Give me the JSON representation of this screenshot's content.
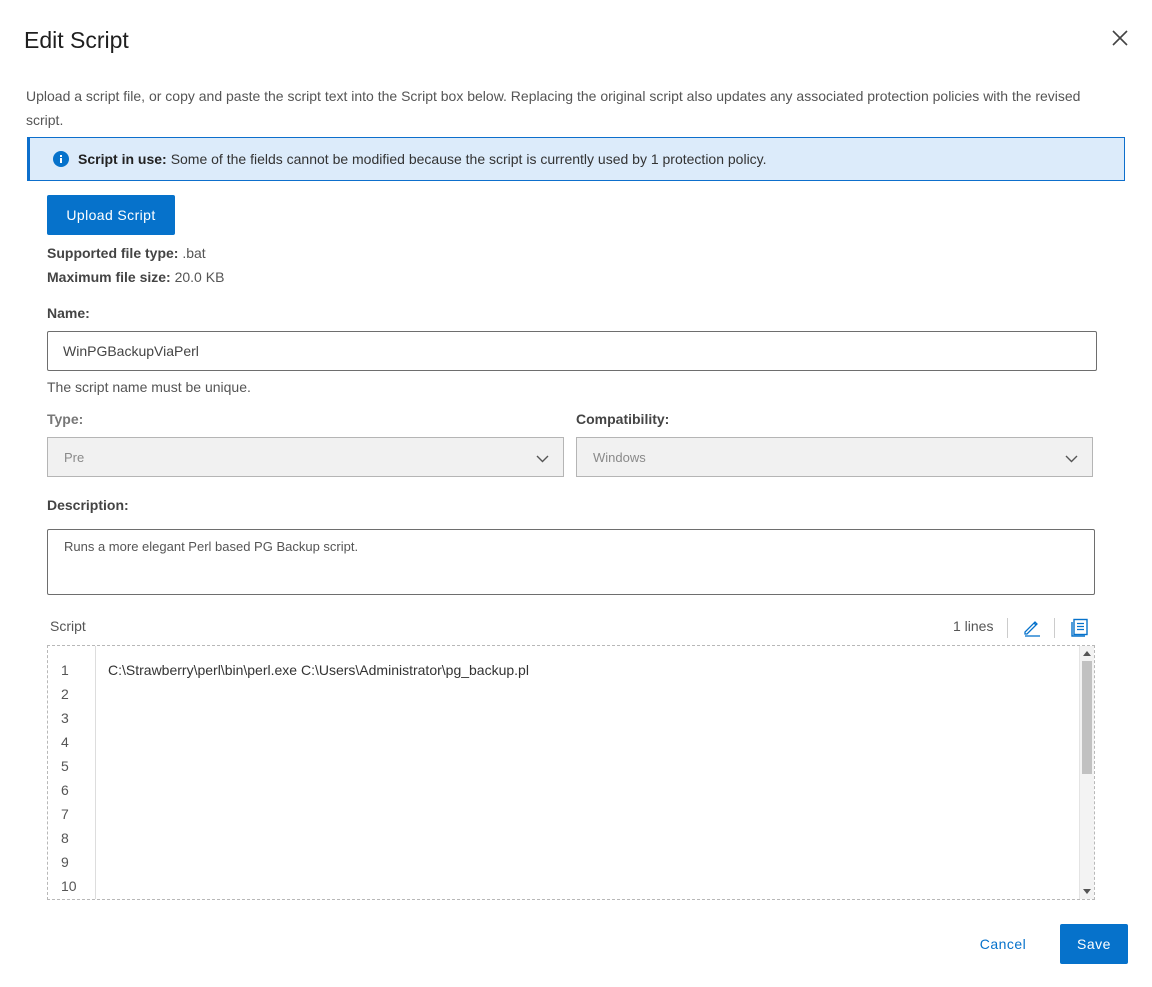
{
  "dialog": {
    "title": "Edit Script",
    "close_icon": "close-icon",
    "intro": "Upload a script file, or copy and paste the script text into the Script box below. Replacing the original script also updates any associated protection policies with the revised script."
  },
  "banner": {
    "icon": "info-icon",
    "bold": "Script in use:",
    "text": "Some of the fields cannot be modified because the script is currently used by 1 protection policy."
  },
  "upload": {
    "button_label": "Upload Script",
    "file_type_label": "Supported file type:",
    "file_type_value": ".bat",
    "max_size_label": "Maximum file size:",
    "max_size_value": "20.0 KB"
  },
  "name_field": {
    "label": "Name:",
    "value": "WinPGBackupViaPerl",
    "hint": "The script name must be unique."
  },
  "type_field": {
    "label": "Type:",
    "value": "Pre"
  },
  "compat_field": {
    "label": "Compatibility:",
    "value": "Windows"
  },
  "description_field": {
    "label": "Description:",
    "value": "Runs a more elegant Perl based PG Backup script."
  },
  "script": {
    "label": "Script",
    "lines_count": "1 lines",
    "edit_icon": "pencil-icon",
    "view_icon": "document-icon",
    "line_numbers": [
      "1",
      "2",
      "3",
      "4",
      "5",
      "6",
      "7",
      "8",
      "9",
      "10"
    ],
    "code": "C:\\Strawberry\\perl\\bin\\perl.exe C:\\Users\\Administrator\\pg_backup.pl",
    "scroll_position": 0.0
  },
  "footer": {
    "cancel_label": "Cancel",
    "save_label": "Save"
  },
  "colors": {
    "accent": "#0672cb",
    "banner_bg": "#dcebfa",
    "banner_border": "#0d6fcc"
  }
}
